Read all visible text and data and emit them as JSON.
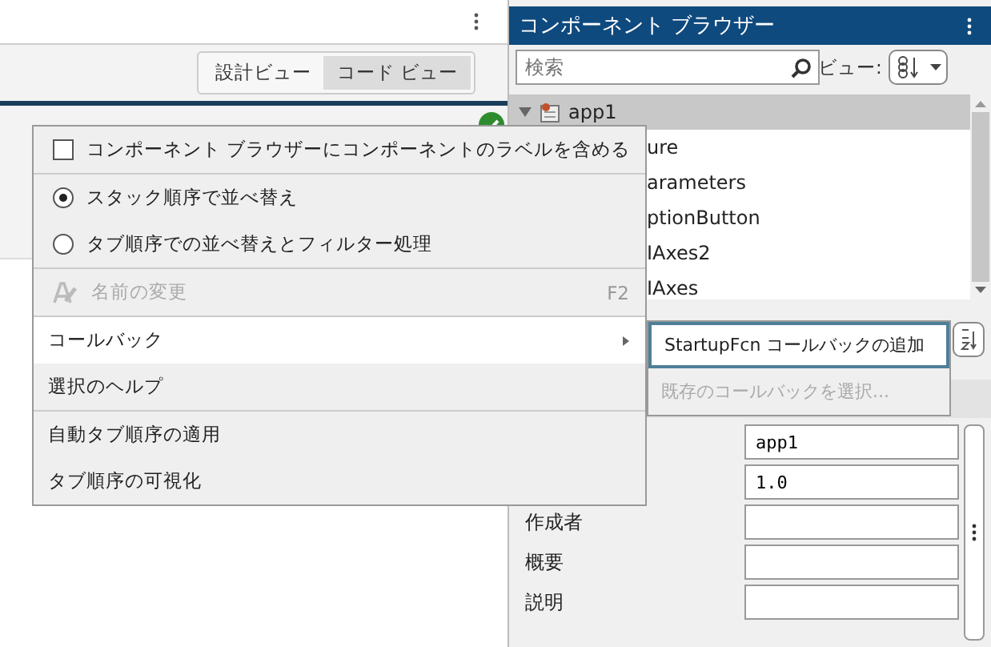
{
  "editor": {
    "view_toggle": [
      {
        "label": "設計ビュー",
        "selected": false
      },
      {
        "label": "コード ビュー",
        "selected": true
      }
    ]
  },
  "component_browser": {
    "title": "コンポーネント ブラウザー",
    "search": {
      "placeholder": "検索"
    },
    "view_label": "ビュー:",
    "tree": [
      {
        "label": "app1",
        "selected": true,
        "expanded": true,
        "children": [
          {
            "label": "ure",
            "selected": false
          },
          {
            "label": "arameters",
            "selected": false
          },
          {
            "label": "ptionButton",
            "selected": false
          },
          {
            "label": "IAxes2",
            "selected": false
          },
          {
            "label": "IAxes",
            "selected": false
          }
        ]
      }
    ],
    "properties": [
      {
        "value": "app1"
      },
      {
        "value": "1.0"
      },
      {
        "label": "作成者"
      },
      {
        "label": "概要"
      },
      {
        "label": "説明"
      }
    ]
  },
  "context_menu": {
    "items": [
      {
        "kind": "check",
        "label": "コンポーネント ブラウザーにコンポーネントのラベルを含める",
        "checked": false
      },
      {
        "kind": "separator"
      },
      {
        "kind": "radio",
        "label": "スタック順序で並べ替え",
        "selected": true
      },
      {
        "kind": "radio",
        "label": "タブ順序での並べ替えとフィルター処理",
        "selected": false
      },
      {
        "kind": "separator"
      },
      {
        "kind": "rename",
        "label": "名前の変更",
        "shortcut": "F2",
        "disabled": true
      },
      {
        "kind": "separator"
      },
      {
        "kind": "submenu",
        "label": "コールバック",
        "highlighted": true
      },
      {
        "kind": "command",
        "label": "選択のヘルプ",
        "disabled": false
      },
      {
        "kind": "separator"
      },
      {
        "kind": "command",
        "label": "自動タブ順序の適用",
        "disabled": false
      },
      {
        "kind": "command",
        "label": "タブ順序の可視化",
        "disabled": false
      }
    ]
  },
  "submenu": {
    "items": [
      {
        "label": "StartupFcn コールバックの追加",
        "highlighted": true,
        "disabled": false
      },
      {
        "label": "既存のコールバックを選択...",
        "highlighted": false,
        "disabled": true
      }
    ]
  }
}
